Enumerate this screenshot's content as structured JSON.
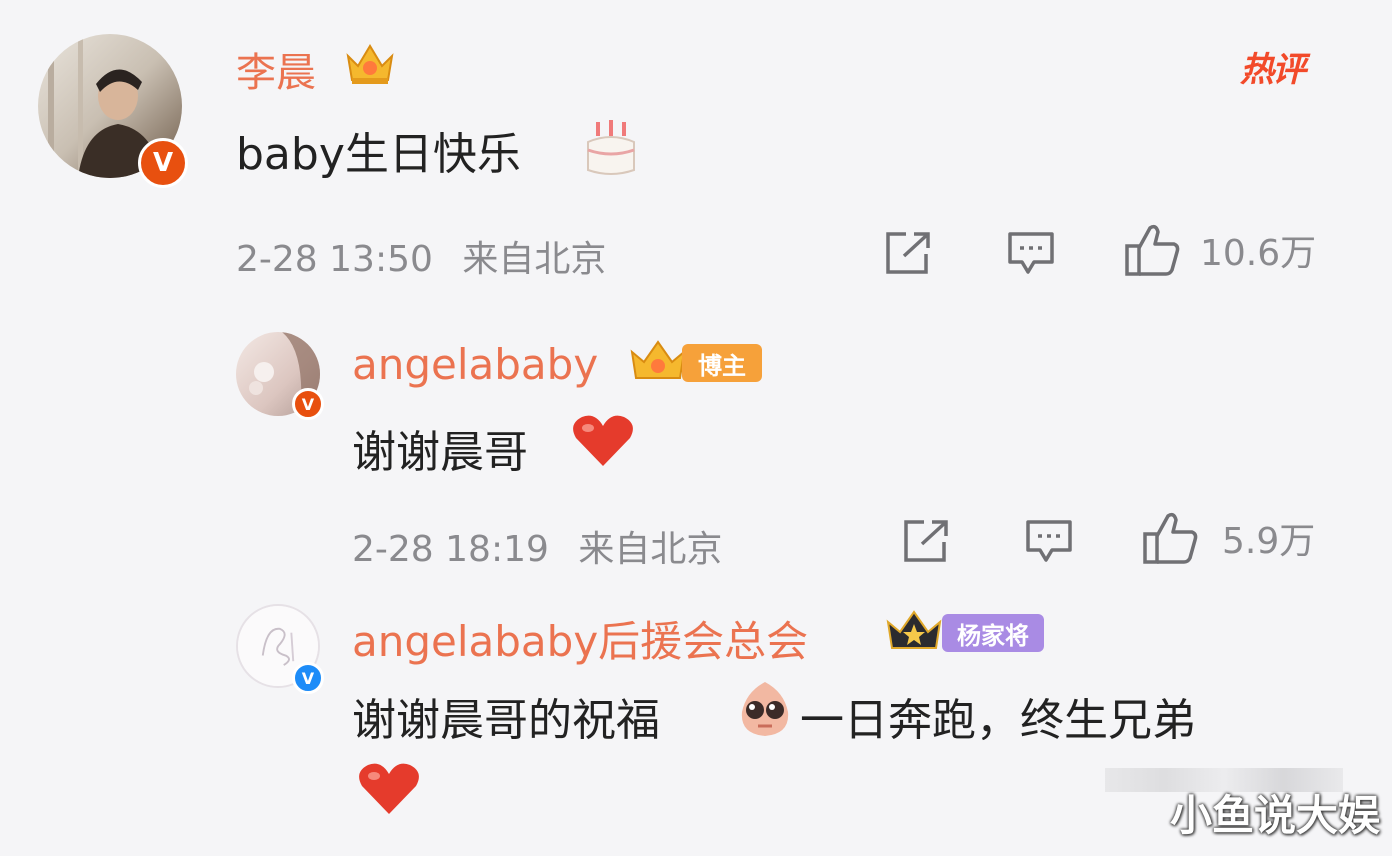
{
  "hot_label": "热评",
  "comments": [
    {
      "name": "李晨",
      "text": "baby生日快乐",
      "time": "2-28 13:50",
      "location": "来自北京",
      "likes": "10.6万"
    },
    {
      "name": "angelababy",
      "tag": "博主",
      "text": "谢谢晨哥",
      "time": "2-28 18:19",
      "location": "来自北京",
      "likes": "5.9万"
    },
    {
      "name": "angelababy后援会总会",
      "tag": "杨家将",
      "text_part1": "谢谢晨哥的祝福",
      "text_part2": "一日奔跑，终生兄弟"
    }
  ],
  "watermark": "小鱼说大娱",
  "icons": [
    "repost-icon",
    "comment-icon",
    "like-icon",
    "verified-icon",
    "crown-icon",
    "cake-emoji",
    "heart-emoji",
    "shy-emoji"
  ],
  "colors": {
    "name": "#eb7350",
    "meta": "#8a8a8e",
    "hot": "#f24a2a",
    "tag_orange": "#f6a13a",
    "tag_purple": "#a98be4"
  }
}
